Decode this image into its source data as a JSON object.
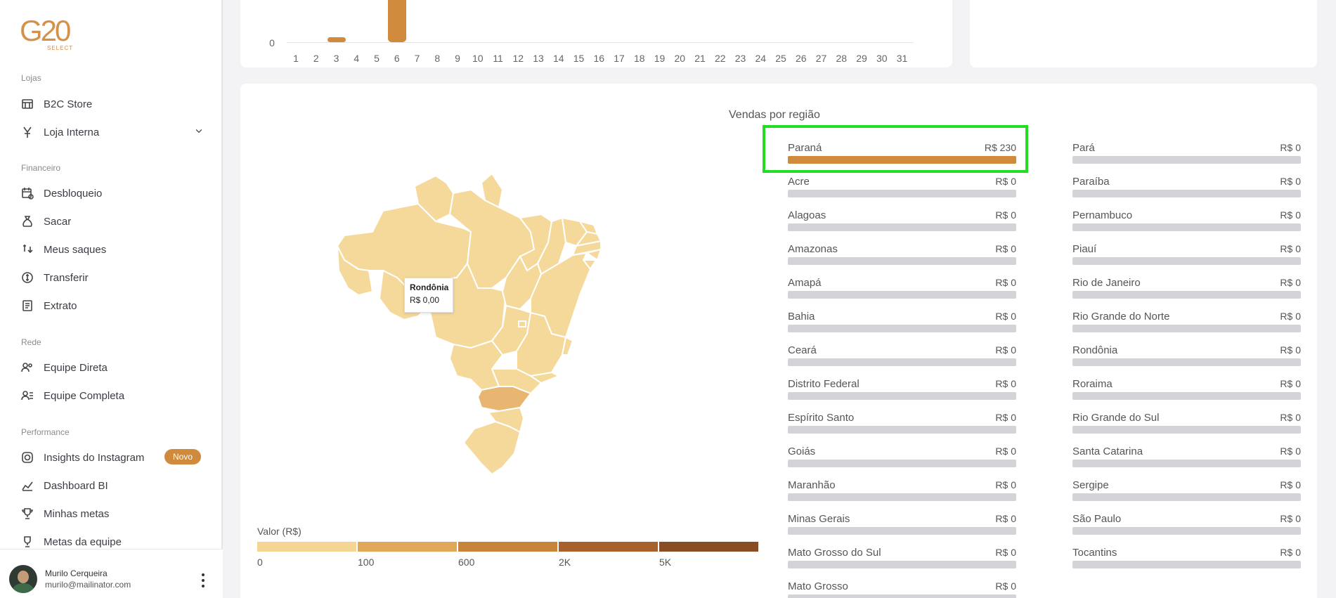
{
  "brand": {
    "logo_text": "G20",
    "logo_sub": "SELECT",
    "accent_color": "#d08a3c"
  },
  "sidebar": {
    "sections": [
      {
        "label": "Lojas"
      },
      {
        "label": "Financeiro"
      },
      {
        "label": "Rede"
      },
      {
        "label": "Performance"
      }
    ],
    "items": [
      {
        "label": "B2C Store",
        "icon": "store-icon"
      },
      {
        "label": "Loja Interna",
        "icon": "yen-icon"
      },
      {
        "label": "Desbloqueio",
        "icon": "calendar-lock-icon"
      },
      {
        "label": "Sacar",
        "icon": "money-bag-icon"
      },
      {
        "label": "Meus saques",
        "icon": "withdraw-icon"
      },
      {
        "label": "Transferir",
        "icon": "transfer-icon"
      },
      {
        "label": "Extrato",
        "icon": "receipt-icon"
      },
      {
        "label": "Equipe Direta",
        "icon": "team-icon"
      },
      {
        "label": "Equipe Completa",
        "icon": "team-list-icon"
      },
      {
        "label": "Insights do Instagram",
        "icon": "instagram-icon",
        "badge": "Novo"
      },
      {
        "label": "Dashboard BI",
        "icon": "chart-icon"
      },
      {
        "label": "Minhas metas",
        "icon": "trophy-icon"
      },
      {
        "label": "Metas da equipe",
        "icon": "team-trophy-icon"
      }
    ]
  },
  "user": {
    "name": "Murilo Cerqueira",
    "email": "murilo@mailinator.com"
  },
  "chart_data": {
    "type": "bar",
    "categories": [
      "1",
      "2",
      "3",
      "4",
      "5",
      "6",
      "7",
      "8",
      "9",
      "10",
      "11",
      "12",
      "13",
      "14",
      "15",
      "16",
      "17",
      "18",
      "19",
      "20",
      "21",
      "22",
      "23",
      "24",
      "25",
      "26",
      "27",
      "28",
      "29",
      "30",
      "31"
    ],
    "y_tick_visible": "0",
    "values": [
      0,
      0,
      20,
      0,
      0,
      210,
      0,
      0,
      0,
      0,
      0,
      0,
      0,
      0,
      0,
      0,
      0,
      0,
      0,
      0,
      0,
      0,
      0,
      0,
      0,
      0,
      0,
      0,
      0,
      0,
      0
    ],
    "ylim_visible_bottom": 0
  },
  "regions": {
    "title": "Vendas por região",
    "tooltip": {
      "name": "Rondônia",
      "value": "R$ 0,00"
    },
    "legend": {
      "title": "Valor (R$)",
      "labels": [
        "0",
        "100",
        "600",
        "2K",
        "5K"
      ],
      "colors": [
        "#f5d594",
        "#e2a85a",
        "#c7843a",
        "#a8612a",
        "#8a4c22"
      ]
    },
    "list_left": [
      {
        "name": "Paraná",
        "value": "R$ 230",
        "fraction": 1.0
      },
      {
        "name": "Acre",
        "value": "R$ 0",
        "fraction": 0
      },
      {
        "name": "Alagoas",
        "value": "R$ 0",
        "fraction": 0
      },
      {
        "name": "Amazonas",
        "value": "R$ 0",
        "fraction": 0
      },
      {
        "name": "Amapá",
        "value": "R$ 0",
        "fraction": 0
      },
      {
        "name": "Bahia",
        "value": "R$ 0",
        "fraction": 0
      },
      {
        "name": "Ceará",
        "value": "R$ 0",
        "fraction": 0
      },
      {
        "name": "Distrito Federal",
        "value": "R$ 0",
        "fraction": 0
      },
      {
        "name": "Espírito Santo",
        "value": "R$ 0",
        "fraction": 0
      },
      {
        "name": "Goiás",
        "value": "R$ 0",
        "fraction": 0
      },
      {
        "name": "Maranhão",
        "value": "R$ 0",
        "fraction": 0
      },
      {
        "name": "Minas Gerais",
        "value": "R$ 0",
        "fraction": 0
      },
      {
        "name": "Mato Grosso do Sul",
        "value": "R$ 0",
        "fraction": 0
      },
      {
        "name": "Mato Grosso",
        "value": "R$ 0",
        "fraction": 0
      }
    ],
    "list_right": [
      {
        "name": "Pará",
        "value": "R$ 0",
        "fraction": 0
      },
      {
        "name": "Paraíba",
        "value": "R$ 0",
        "fraction": 0
      },
      {
        "name": "Pernambuco",
        "value": "R$ 0",
        "fraction": 0
      },
      {
        "name": "Piauí",
        "value": "R$ 0",
        "fraction": 0
      },
      {
        "name": "Rio de Janeiro",
        "value": "R$ 0",
        "fraction": 0
      },
      {
        "name": "Rio Grande do Norte",
        "value": "R$ 0",
        "fraction": 0
      },
      {
        "name": "Rondônia",
        "value": "R$ 0",
        "fraction": 0
      },
      {
        "name": "Roraima",
        "value": "R$ 0",
        "fraction": 0
      },
      {
        "name": "Rio Grande do Sul",
        "value": "R$ 0",
        "fraction": 0
      },
      {
        "name": "Santa Catarina",
        "value": "R$ 0",
        "fraction": 0
      },
      {
        "name": "Sergipe",
        "value": "R$ 0",
        "fraction": 0
      },
      {
        "name": "São Paulo",
        "value": "R$ 0",
        "fraction": 0
      },
      {
        "name": "Tocantins",
        "value": "R$ 0",
        "fraction": 0
      }
    ]
  }
}
